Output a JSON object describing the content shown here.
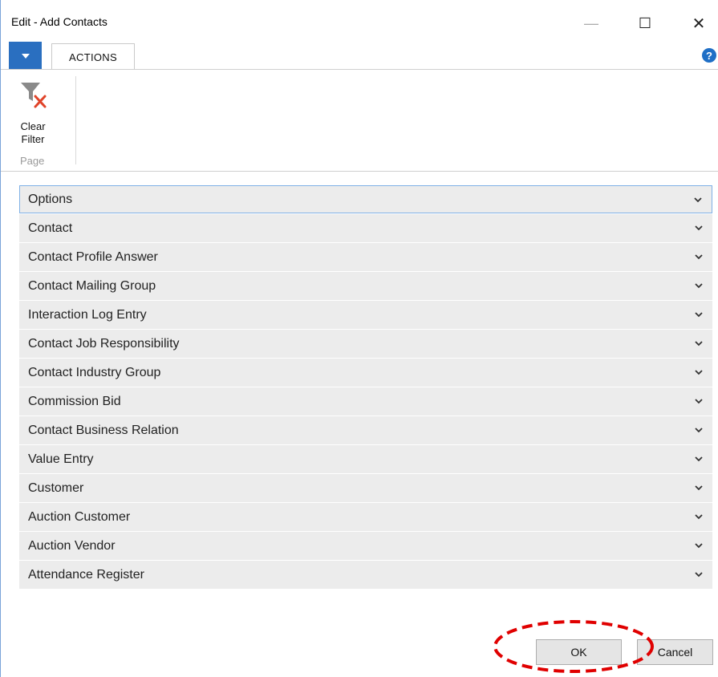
{
  "window": {
    "title": "Edit - Add Contacts",
    "controls": {
      "minimize": "—",
      "maximize": "☐",
      "close": "✕"
    }
  },
  "ribbon": {
    "tabs": [
      {
        "label": "ACTIONS",
        "active": true
      }
    ],
    "help_icon": "?",
    "groups": [
      {
        "label": "Page",
        "actions": [
          {
            "label": "Clear Filter",
            "icon": "clear-filter-icon"
          }
        ]
      }
    ]
  },
  "sections": [
    {
      "label": "Options"
    },
    {
      "label": "Contact"
    },
    {
      "label": "Contact Profile Answer"
    },
    {
      "label": "Contact Mailing Group"
    },
    {
      "label": "Interaction Log Entry"
    },
    {
      "label": "Contact Job Responsibility"
    },
    {
      "label": "Contact Industry Group"
    },
    {
      "label": "Commission Bid"
    },
    {
      "label": "Contact Business Relation"
    },
    {
      "label": "Value Entry"
    },
    {
      "label": "Customer"
    },
    {
      "label": "Auction Customer"
    },
    {
      "label": "Auction Vendor"
    },
    {
      "label": "Attendance Register"
    }
  ],
  "footer": {
    "ok_label": "OK",
    "cancel_label": "Cancel"
  },
  "colors": {
    "accent": "#2a6fc0",
    "section_bg": "#ececec",
    "focus_border": "#7fb0e6",
    "highlight": "#e00000"
  }
}
